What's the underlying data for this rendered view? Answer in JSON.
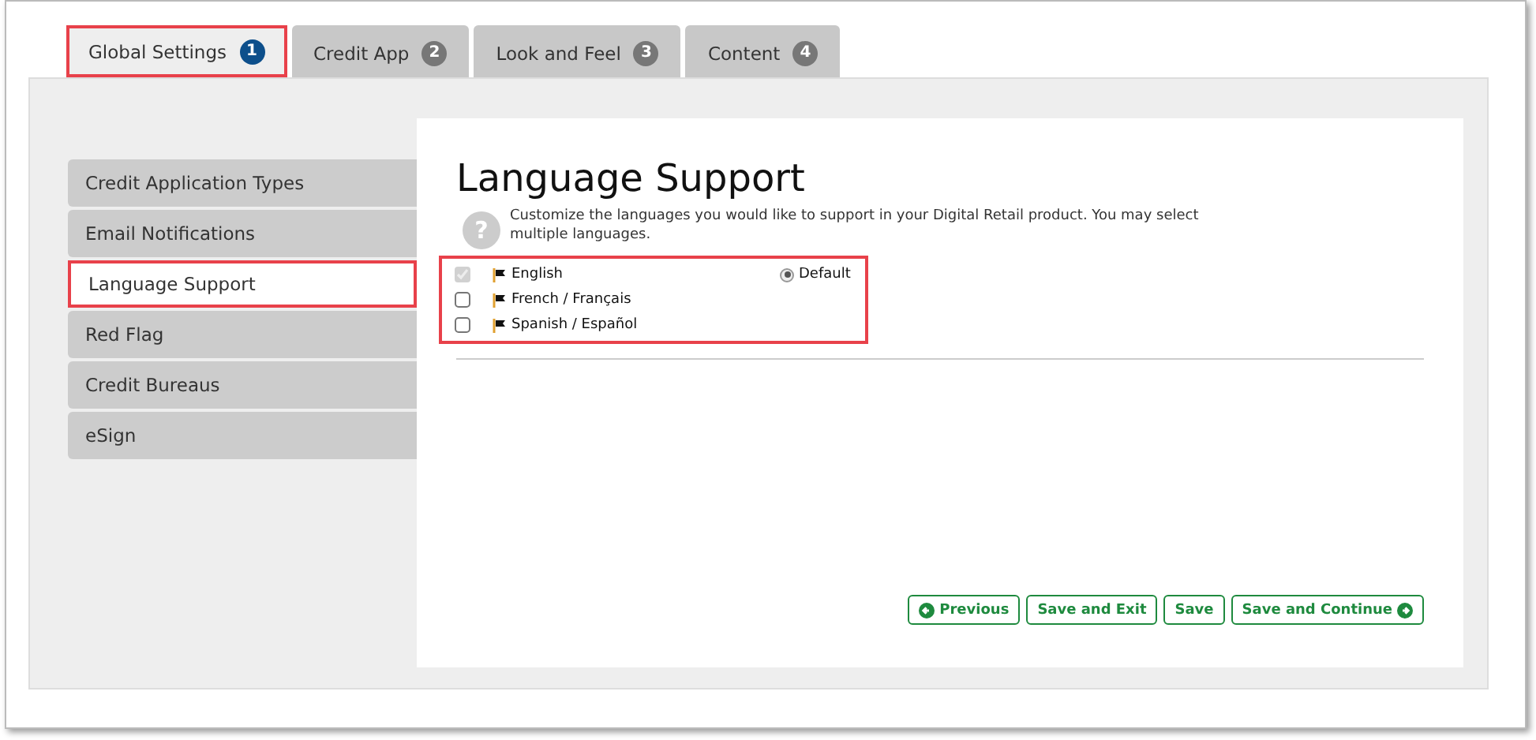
{
  "tabs": [
    {
      "label": "Global Settings",
      "badge": "1",
      "selected": true
    },
    {
      "label": "Credit App",
      "badge": "2",
      "selected": false
    },
    {
      "label": "Look and Feel",
      "badge": "3",
      "selected": false
    },
    {
      "label": "Content",
      "badge": "4",
      "selected": false
    }
  ],
  "sidebar": {
    "items": [
      {
        "label": "Credit Application Types",
        "selected": false
      },
      {
        "label": "Email Notifications",
        "selected": false
      },
      {
        "label": "Language Support",
        "selected": true
      },
      {
        "label": "Red Flag",
        "selected": false
      },
      {
        "label": "Credit Bureaus",
        "selected": false
      },
      {
        "label": "eSign",
        "selected": false
      }
    ]
  },
  "content": {
    "title": "Language Support",
    "help_icon": "?",
    "help": "Customize the languages you would like to support in your Digital Retail product. You may select multiple languages.",
    "languages": [
      {
        "name": "English",
        "checked": true,
        "disabled": true,
        "default_label": "Default",
        "default_selected": true
      },
      {
        "name": "French / Français",
        "checked": false,
        "disabled": false
      },
      {
        "name": "Spanish / Español",
        "checked": false,
        "disabled": false
      }
    ],
    "buttons": [
      {
        "label": "Previous",
        "kind": "back"
      },
      {
        "label": "Save and Exit",
        "kind": "plain"
      },
      {
        "label": "Save",
        "kind": "plain"
      },
      {
        "label": "Save and Continue",
        "kind": "forward"
      }
    ]
  }
}
